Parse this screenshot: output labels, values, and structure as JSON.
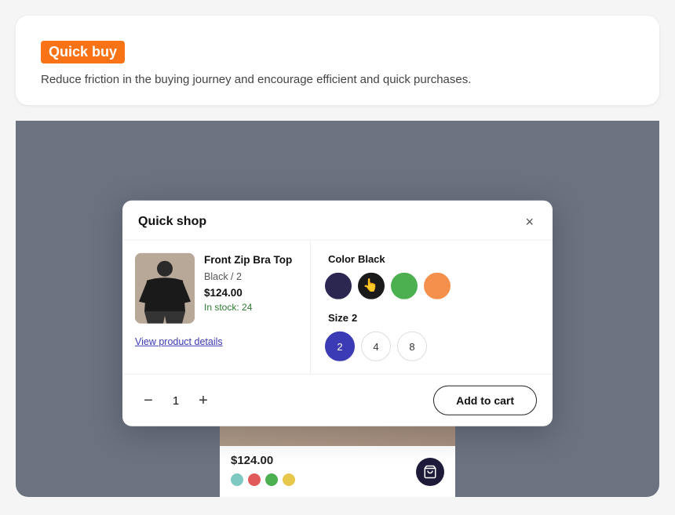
{
  "header": {
    "title": "Quick buy",
    "description": "Reduce friction in the buying journey and encourage efficient and quick purchases."
  },
  "modal": {
    "title": "Quick shop",
    "close_label": "×",
    "product": {
      "name": "Front Zip Bra Top",
      "variant": "Black / 2",
      "price": "$124.00",
      "stock": "In stock: 24",
      "view_details_label": "View product details"
    },
    "color_section": {
      "label": "Color",
      "selected": "Black",
      "swatches": [
        {
          "name": "dark-navy",
          "color": "#2b2750"
        },
        {
          "name": "black",
          "color": "#1a1a1a",
          "has_cursor": true
        },
        {
          "name": "green",
          "color": "#4caf50"
        },
        {
          "name": "orange",
          "color": "#f5904c"
        }
      ]
    },
    "size_section": {
      "label": "Size",
      "selected": "2",
      "options": [
        "2",
        "4",
        "8"
      ]
    },
    "quantity": {
      "minus_label": "−",
      "value": "1",
      "plus_label": "+"
    },
    "add_to_cart_label": "Add to cart"
  },
  "bg_product": {
    "price": "$124.00",
    "color_dots": [
      {
        "color": "#7ecac3"
      },
      {
        "color": "#e05a5a"
      },
      {
        "color": "#4caf50"
      },
      {
        "color": "#e8c84a"
      }
    ]
  }
}
